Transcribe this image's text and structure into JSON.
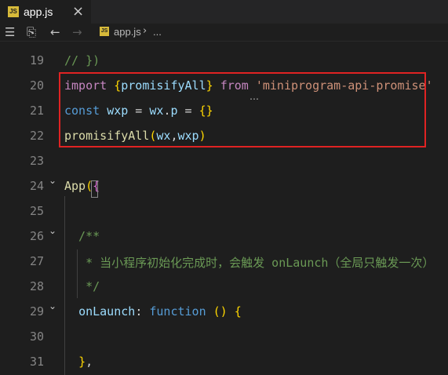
{
  "tab": {
    "icon_text": "JS",
    "label": "app.js",
    "close": "×"
  },
  "toolbar": {
    "list_icon": "☰",
    "bookmark_icon": "⎘",
    "back_icon": "←",
    "forward_icon": "→",
    "breadcrumb_icon_text": "JS",
    "breadcrumb_file": "app.js",
    "breadcrumb_sep": "›",
    "breadcrumb_more": "..."
  },
  "editor": {
    "lines": [
      {
        "no": "19",
        "tokens": [
          [
            "cmt",
            "// })"
          ]
        ]
      },
      {
        "no": "20",
        "tokens": [
          [
            "kw2",
            "import"
          ],
          [
            "plain",
            " "
          ],
          [
            "br1",
            "{"
          ],
          [
            "var",
            "promisifyAll"
          ],
          [
            "br1",
            "}"
          ],
          [
            "plain",
            " "
          ],
          [
            "kw2",
            "from"
          ],
          [
            "plain",
            " "
          ],
          [
            "str",
            "'miniprogram-api-promise'"
          ]
        ]
      },
      {
        "no": "21",
        "tokens": [
          [
            "kw",
            "const"
          ],
          [
            "plain",
            " "
          ],
          [
            "var",
            "wxp"
          ],
          [
            "plain",
            " = "
          ],
          [
            "var",
            "wx"
          ],
          [
            "plain",
            "."
          ],
          [
            "var",
            "p"
          ],
          [
            "plain",
            " = "
          ],
          [
            "br1",
            "{}"
          ]
        ]
      },
      {
        "no": "22",
        "tokens": [
          [
            "fn",
            "promisifyAll"
          ],
          [
            "br1",
            "("
          ],
          [
            "var",
            "wx"
          ],
          [
            "plain",
            ","
          ],
          [
            "var",
            "wxp"
          ],
          [
            "br1",
            ")"
          ]
        ]
      },
      {
        "no": "23",
        "tokens": []
      },
      {
        "no": "24",
        "tokens": [
          [
            "fn",
            "App"
          ],
          [
            "br1",
            "("
          ],
          [
            "br2",
            "{"
          ]
        ]
      },
      {
        "no": "25",
        "tokens": []
      },
      {
        "no": "26",
        "tokens": [
          [
            "cmt",
            "  /**"
          ]
        ]
      },
      {
        "no": "27",
        "tokens": [
          [
            "cmt",
            "   * 当小程序初始化完成时，会触发 onLaunch（全局只触发一次）"
          ]
        ]
      },
      {
        "no": "28",
        "tokens": [
          [
            "cmt",
            "   */"
          ]
        ]
      },
      {
        "no": "29",
        "tokens": [
          [
            "plain",
            "  "
          ],
          [
            "var",
            "onLaunch"
          ],
          [
            "plain",
            ": "
          ],
          [
            "kw",
            "function"
          ],
          [
            "plain",
            " "
          ],
          [
            "br1",
            "()"
          ],
          [
            "plain",
            " "
          ],
          [
            "br1",
            "{"
          ]
        ]
      },
      {
        "no": "30",
        "tokens": []
      },
      {
        "no": "31",
        "tokens": [
          [
            "plain",
            "  "
          ],
          [
            "br1",
            "}"
          ],
          [
            "plain",
            ","
          ]
        ]
      }
    ],
    "hover_ellipsis": "…"
  }
}
